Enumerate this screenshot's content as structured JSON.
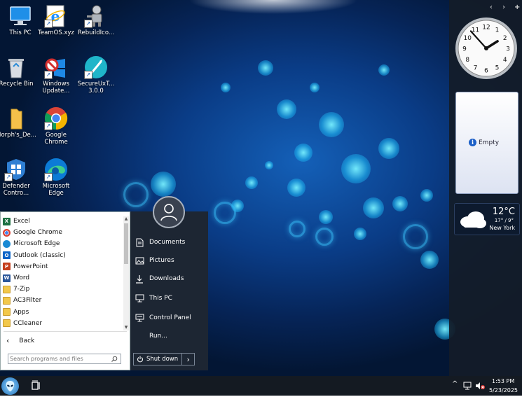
{
  "desktop_icons": [
    {
      "label": "This PC",
      "icon": "this-pc-icon"
    },
    {
      "label": "TeamOS.xyz",
      "icon": "internet-explorer-icon"
    },
    {
      "label": "RebuildIco...",
      "icon": "robot-icon"
    },
    {
      "label": "Recycle Bin",
      "icon": "recycle-bin-icon"
    },
    {
      "label": "Windows Update...",
      "icon": "windows-update-icon"
    },
    {
      "label": "SecureUxT... 3.0.0",
      "icon": "secureux-icon"
    },
    {
      "label": "Morph's_De...",
      "icon": "folder-icon"
    },
    {
      "label": "Google Chrome",
      "icon": "chrome-icon"
    },
    {
      "label": "Defender Contro...",
      "icon": "defender-icon"
    },
    {
      "label": "Microsoft Edge",
      "icon": "edge-icon"
    }
  ],
  "gadgets": {
    "nav": [
      "‹",
      "›",
      "+"
    ],
    "clock": {
      "numerals": [
        "12",
        "1",
        "2",
        "3",
        "4",
        "5",
        "6",
        "7",
        "8",
        "9",
        "10",
        "11"
      ],
      "hour": 1.93,
      "minute": 53
    },
    "notes": {
      "label": "Empty"
    },
    "weather": {
      "temp": "12°C",
      "range": "17° / 9°",
      "city": "New York"
    }
  },
  "start_menu": {
    "programs": [
      {
        "label": "Excel",
        "color": "#1d6f42",
        "glyph": "X"
      },
      {
        "label": "Google Chrome",
        "color": "#db4437",
        "glyph": ""
      },
      {
        "label": "Microsoft Edge",
        "color": "#1a8ad4",
        "glyph": ""
      },
      {
        "label": "Outlook (classic)",
        "color": "#0a64c8",
        "glyph": "O"
      },
      {
        "label": "PowerPoint",
        "color": "#c43e1c",
        "glyph": "P"
      },
      {
        "label": "Word",
        "color": "#2b579a",
        "glyph": "W"
      },
      {
        "label": "7-Zip",
        "color": "#f2c84b",
        "glyph": ""
      },
      {
        "label": "AC3Filter",
        "color": "#f2c84b",
        "glyph": ""
      },
      {
        "label": "Apps",
        "color": "#f2c84b",
        "glyph": ""
      },
      {
        "label": "CCleaner",
        "color": "#f2c84b",
        "glyph": ""
      }
    ],
    "back_label": "Back",
    "search_placeholder": "Search programs and files",
    "right_items": [
      {
        "label": "Documents",
        "icon": "documents-icon"
      },
      {
        "label": "Pictures",
        "icon": "pictures-icon"
      },
      {
        "label": "Downloads",
        "icon": "downloads-icon"
      },
      {
        "label": "This PC",
        "icon": "this-pc-icon"
      },
      {
        "label": "Control Panel",
        "icon": "control-panel-icon"
      },
      {
        "label": "Run...",
        "icon": "run-icon"
      }
    ],
    "shutdown_label": "Shut down"
  },
  "taskbar": {
    "time": "1:53 PM",
    "date": "5/23/2025"
  }
}
